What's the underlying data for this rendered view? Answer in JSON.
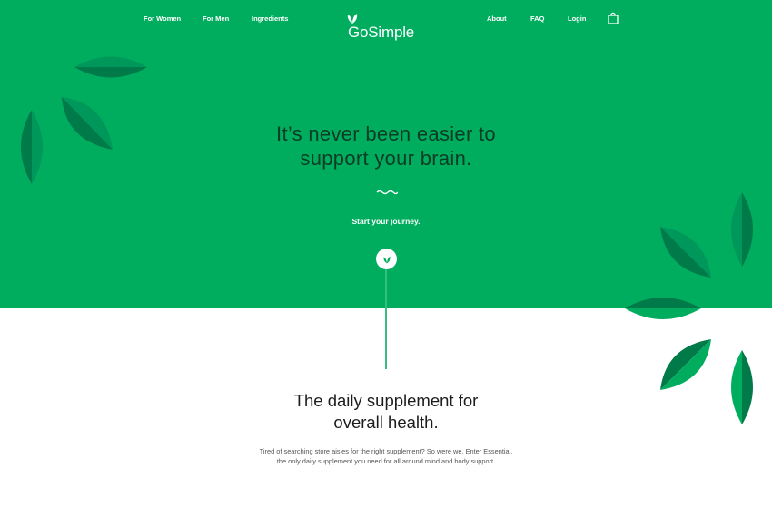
{
  "nav": {
    "left_links": [
      "For Women",
      "For Men",
      "Ingredients"
    ],
    "right_links": [
      "About",
      "FAQ",
      "Login"
    ],
    "logo_text": "GoSimple",
    "logo_icon": "leaf-logo-icon",
    "cart_icon": "shopping-bag-icon"
  },
  "hero": {
    "title_line1": "It’s never been easier to",
    "title_line2": "support your brain.",
    "cta_text": "Start your journey.",
    "circle_icon": "leaf-icon",
    "divider_icon": "squiggle-icon"
  },
  "section": {
    "title_line1": "The daily supplement for",
    "title_line2": "overall health.",
    "body": "Tired of searching store aisles for the right supplement? So were we. Enter Essential, the only daily supplement you need for all around mind and body support."
  },
  "colors": {
    "hero_green": "#00ad5f",
    "leaf_dark": "#007a48",
    "leaf_mid": "#00975a",
    "title_dark": "#0b3d24"
  }
}
